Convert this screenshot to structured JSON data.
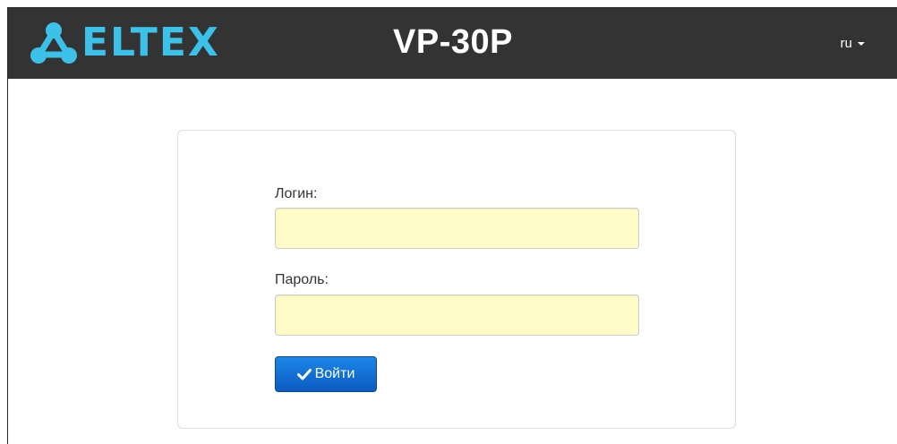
{
  "header": {
    "logo_text": "ELTEX",
    "app_title": "VP-30P",
    "language": "ru",
    "logo_icon": "eltex-network-icon",
    "language_caret_icon": "caret-down-icon",
    "background_color": "#333333",
    "logo_color": "#3cc1e8"
  },
  "login_form": {
    "login_label": "Логин:",
    "login_value": "",
    "password_label": "Пароль:",
    "password_value": "",
    "submit_label": "Войти",
    "submit_icon": "check-icon",
    "input_background": "#fffcc8",
    "button_color": "#0d5bc2"
  }
}
